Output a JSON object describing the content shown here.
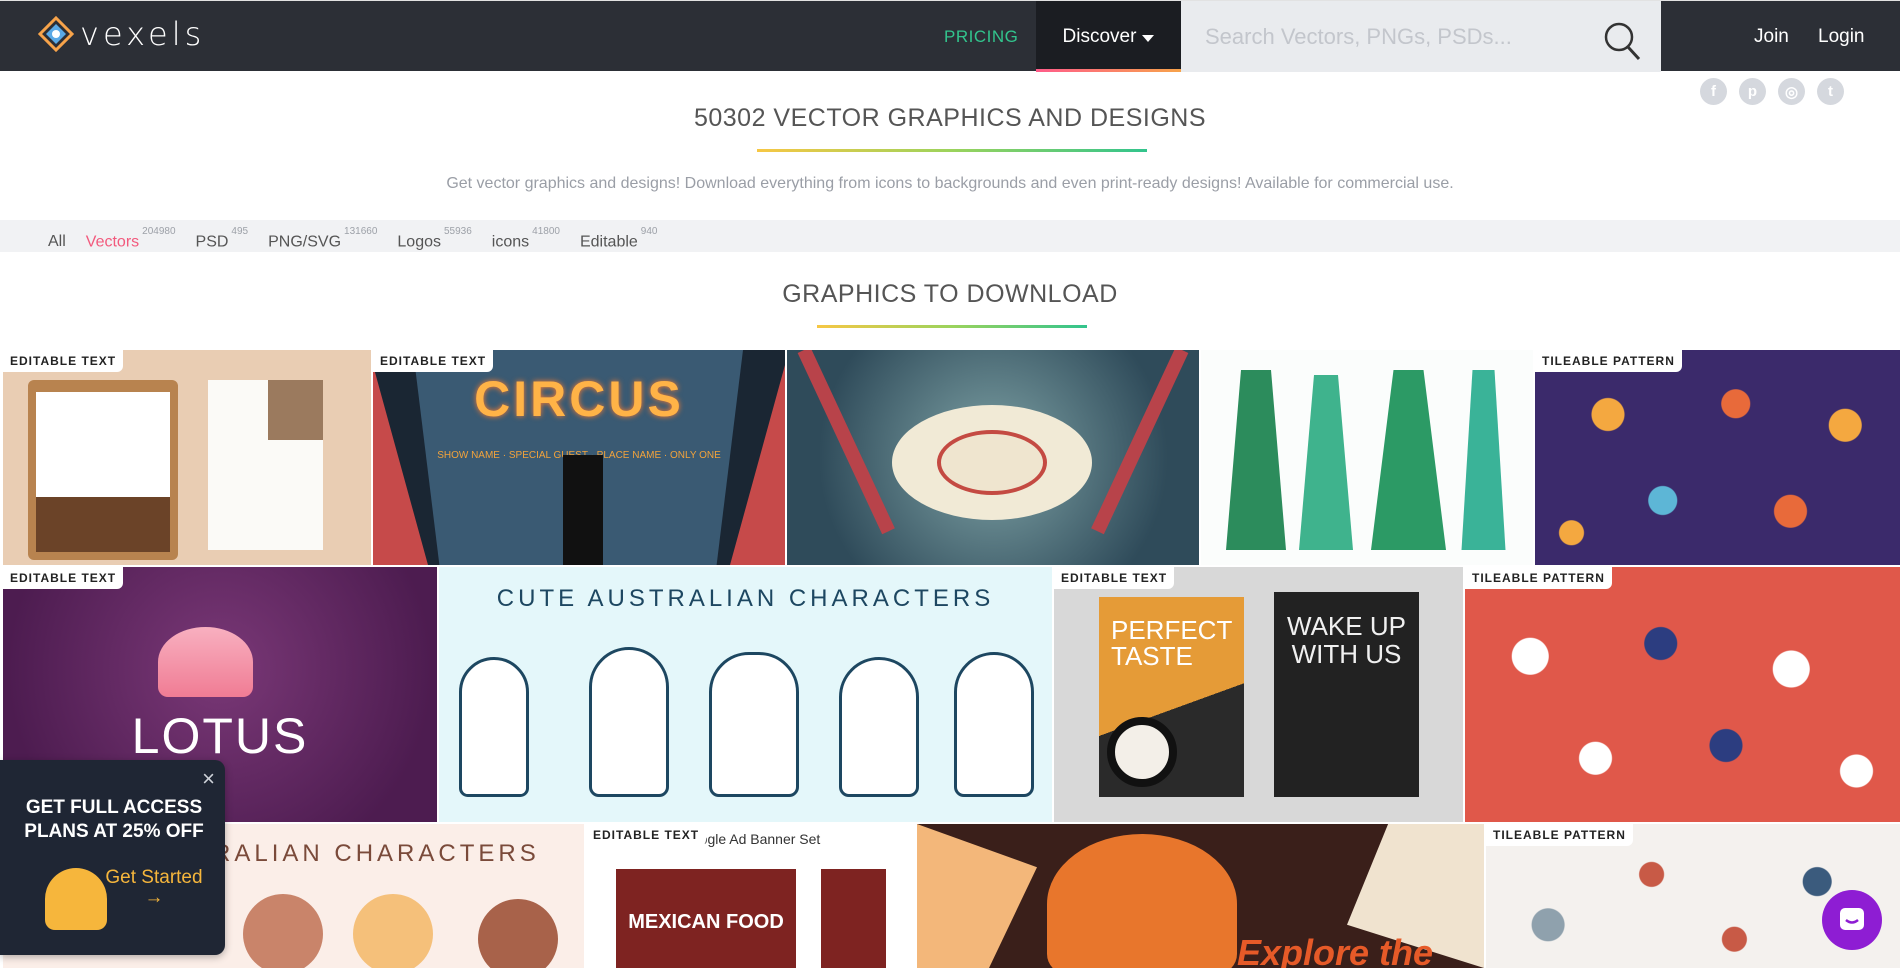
{
  "header": {
    "logo_text": "vexels",
    "pricing_label": "PRICING",
    "discover_label": "Discover",
    "search_placeholder": "Search Vectors, PNGs, PSDs...",
    "join_label": "Join",
    "login_label": "Login",
    "social": [
      "f",
      "p",
      "◎",
      "t"
    ]
  },
  "hero": {
    "title": "50302 VECTOR GRAPHICS AND DESIGNS",
    "subtitle": "Get vector graphics and designs! Download everything from icons to backgrounds and even print-ready designs! Available for commercial use."
  },
  "filters": [
    {
      "label": "All",
      "count": ""
    },
    {
      "label": "Vectors",
      "count": "204980"
    },
    {
      "label": "PSD",
      "count": "495"
    },
    {
      "label": "PNG/SVG",
      "count": "131660"
    },
    {
      "label": "Logos",
      "count": "55936"
    },
    {
      "label": "icons",
      "count": "41800"
    },
    {
      "label": "Editable",
      "count": "940"
    }
  ],
  "section_title": "GRAPHICS TO DOWNLOAD",
  "tiles": [
    {
      "tag": "EDITABLE TEXT",
      "text": ""
    },
    {
      "tag": "EDITABLE TEXT",
      "text": "CIRCUS",
      "text2": "SHOW NAME · SPECIAL GUEST · PLACE NAME · ONLY ONE SHOW"
    },
    {
      "tag": "",
      "text": ""
    },
    {
      "tag": "",
      "text": ""
    },
    {
      "tag": "TILEABLE PATTERN",
      "text": ""
    },
    {
      "tag": "EDITABLE TEXT",
      "text": "LOTUS"
    },
    {
      "tag": "",
      "text": "CUTE AUSTRALIAN CHARACTERS"
    },
    {
      "tag": "EDITABLE TEXT",
      "text": "PERFECT TASTE",
      "text2": "WAKE UP WITH US"
    },
    {
      "tag": "TILEABLE PATTERN",
      "text": ""
    },
    {
      "tag": "",
      "text": "RALIAN CHARACTERS"
    },
    {
      "tag": "EDITABLE TEXT",
      "text": "Google Ad Banner Set",
      "text2": "MEXICAN FOOD"
    },
    {
      "tag": "",
      "text": "Explore the"
    },
    {
      "tag": "TILEABLE PATTERN",
      "text": ""
    }
  ],
  "popup": {
    "title": "GET FULL ACCESS PLANS AT 25% OFF",
    "cta": "Get Started →"
  }
}
